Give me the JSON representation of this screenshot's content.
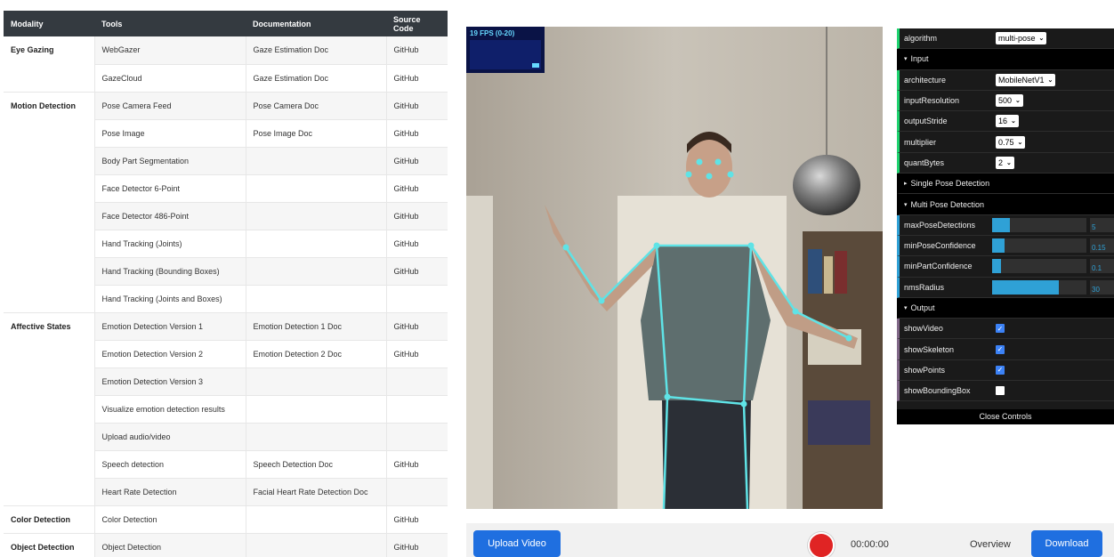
{
  "table": {
    "headers": [
      "Modality",
      "Tools",
      "Documentation",
      "Source Code"
    ],
    "groups": [
      {
        "modality": "Eye Gazing",
        "rows": [
          {
            "tool": "WebGazer",
            "doc": "Gaze Estimation Doc",
            "src": "GitHub"
          },
          {
            "tool": "GazeCloud",
            "doc": "Gaze Estimation Doc",
            "src": "GitHub"
          }
        ]
      },
      {
        "modality": "Motion Detection",
        "rows": [
          {
            "tool": "Pose Camera Feed",
            "doc": "Pose Camera Doc",
            "src": "GitHub"
          },
          {
            "tool": "Pose Image",
            "doc": "Pose Image Doc",
            "src": "GitHub"
          },
          {
            "tool": "Body Part Segmentation",
            "doc": "",
            "src": "GitHub"
          },
          {
            "tool": "Face Detector 6-Point",
            "doc": "",
            "src": "GitHub"
          },
          {
            "tool": "Face Detector 486-Point",
            "doc": "",
            "src": "GitHub"
          },
          {
            "tool": "Hand Tracking (Joints)",
            "doc": "",
            "src": "GitHub"
          },
          {
            "tool": "Hand Tracking (Bounding Boxes)",
            "doc": "",
            "src": "GitHub"
          },
          {
            "tool": "Hand Tracking (Joints and Boxes)",
            "doc": "",
            "src": ""
          }
        ]
      },
      {
        "modality": "Affective States",
        "rows": [
          {
            "tool": "Emotion Detection Version 1",
            "doc": "Emotion Detection 1 Doc",
            "src": "GitHub"
          },
          {
            "tool": "Emotion Detection Version 2",
            "doc": "Emotion Detection 2 Doc",
            "src": "GitHub"
          },
          {
            "tool": "Emotion Detection Version 3",
            "doc": "",
            "src": ""
          },
          {
            "tool": "Visualize emotion detection results",
            "doc": "",
            "src": ""
          },
          {
            "tool": "Upload audio/video",
            "doc": "",
            "src": ""
          },
          {
            "tool": "Speech detection",
            "doc": "Speech Detection Doc",
            "src": "GitHub"
          },
          {
            "tool": "Heart Rate Detection",
            "doc": "Facial Heart Rate Detection Doc",
            "src": ""
          }
        ]
      },
      {
        "modality": "Color Detection",
        "rows": [
          {
            "tool": "Color Detection",
            "doc": "",
            "src": "GitHub"
          }
        ]
      },
      {
        "modality": "Object Detection",
        "rows": [
          {
            "tool": "Object Detection",
            "doc": "",
            "src": "GitHub"
          }
        ]
      }
    ]
  },
  "fps": {
    "label": "19 FPS (0-20)"
  },
  "controls": {
    "algorithm_label": "algorithm",
    "algorithm_value": "multi-pose",
    "input_folder": "Input",
    "architecture_label": "architecture",
    "architecture_value": "MobileNetV1",
    "inputResolution_label": "inputResolution",
    "inputResolution_value": "500",
    "outputStride_label": "outputStride",
    "outputStride_value": "16",
    "multiplier_label": "multiplier",
    "multiplier_value": "0.75",
    "quantBytes_label": "quantBytes",
    "quantBytes_value": "2",
    "single_folder": "Single Pose Detection",
    "multi_folder": "Multi Pose Detection",
    "sliders": [
      {
        "label": "maxPoseDetections",
        "value": "5",
        "fraction": 0.19
      },
      {
        "label": "minPoseConfidence",
        "value": "0.15",
        "fraction": 0.13
      },
      {
        "label": "minPartConfidence",
        "value": "0.1",
        "fraction": 0.09
      },
      {
        "label": "nmsRadius",
        "value": "30",
        "fraction": 0.71
      }
    ],
    "output_folder": "Output",
    "checkboxes": [
      {
        "label": "showVideo",
        "checked": true
      },
      {
        "label": "showSkeleton",
        "checked": true
      },
      {
        "label": "showPoints",
        "checked": true
      },
      {
        "label": "showBoundingBox",
        "checked": false
      }
    ],
    "close_label": "Close Controls"
  },
  "bottom": {
    "upload_label": "Upload Video",
    "timer": "00:00:00",
    "overview_label": "Overview",
    "download_label": "Download"
  },
  "colors": {
    "skeleton": "#5fe3e6",
    "accent": "#1f6fe0",
    "record": "#e02424"
  }
}
